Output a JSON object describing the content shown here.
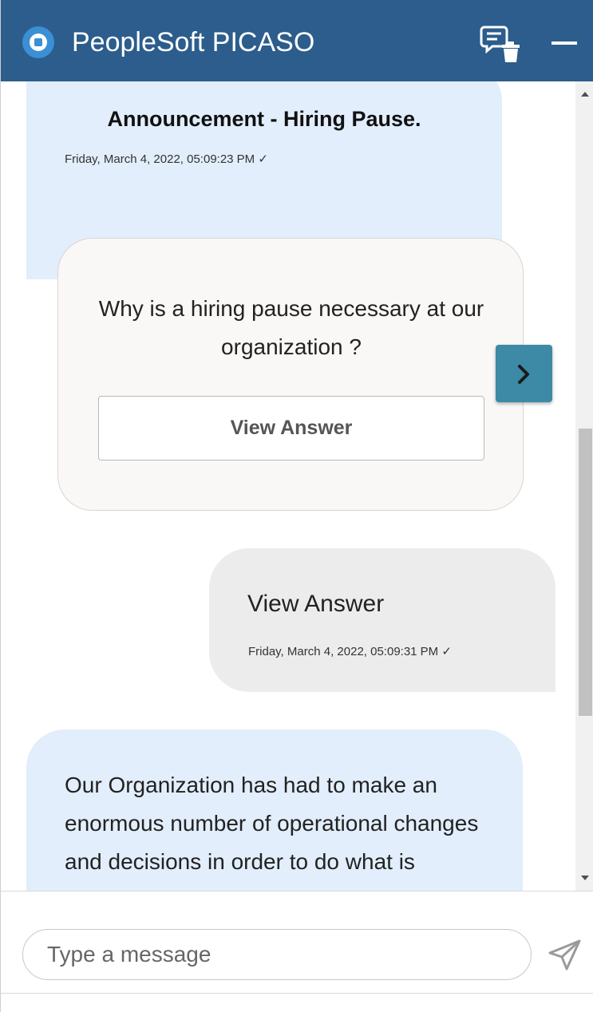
{
  "header": {
    "title": "PeopleSoft PICASO",
    "logo_icon": "headset-bot-icon",
    "chat_icon": "chat-clear-icon",
    "minimize_icon": "minimize-icon",
    "background": "#2c5d8c"
  },
  "messages": [
    {
      "sender": "bot",
      "title": "Announcement - Hiring Pause.",
      "timestamp": "Friday, March 4, 2022, 05:09:23 PM ✓"
    },
    {
      "sender": "bot",
      "type": "card",
      "question": "Why is a hiring pause necessary at our organization ?",
      "button_label": "View Answer"
    },
    {
      "sender": "user",
      "text": "View Answer",
      "timestamp": "Friday, March 4, 2022, 05:09:31 PM ✓"
    },
    {
      "sender": "bot",
      "text": "Our Organization has had to make an enormous number of operational changes and decisions in order to do what is necessary to help mitigate"
    }
  ],
  "carousel": {
    "next_icon": "chevron-right-icon"
  },
  "composer": {
    "placeholder": "Type a message",
    "value": "",
    "send_icon": "send-icon"
  },
  "colors": {
    "bot_bubble": "#e2eefc",
    "user_bubble": "#ececec",
    "card_bg": "#faf8f6",
    "next_button": "#3c8aa6"
  }
}
